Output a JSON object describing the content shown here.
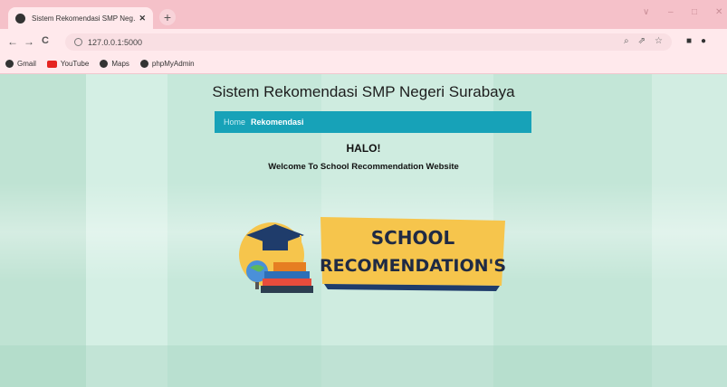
{
  "browser": {
    "tab_title": "Sistem Rekomendasi SMP Neg…",
    "tab_close": "✕",
    "new_tab": "+",
    "url": "127.0.0.1:5000",
    "nav_icons": {
      "back": "←",
      "forward": "→",
      "reload": "C"
    },
    "window_controls": {
      "minimize": "–",
      "maximize": "□",
      "close": "✕",
      "dropdown": "∨"
    },
    "omnibox_icons": {
      "zoom": "⌕",
      "share": "⇗",
      "star": "☆"
    },
    "extension_icons": {
      "sidepanel": "■",
      "profile": "●"
    },
    "bookmarks": [
      {
        "label": "Gmail",
        "icon": "globe-icon"
      },
      {
        "label": "YouTube",
        "icon": "youtube-icon"
      },
      {
        "label": "Maps",
        "icon": "globe-icon"
      },
      {
        "label": "phpMyAdmin",
        "icon": "globe-icon"
      }
    ]
  },
  "page": {
    "site_title": "Sistem Rekomendasi SMP Negeri Surabaya",
    "nav": {
      "home": "Home",
      "rekomendasi": "Rekomendasi"
    },
    "greeting": "HALO!",
    "welcome": "Welcome To School Recommendation Website",
    "banner": {
      "line1": "SCHOOL",
      "line2": "RECOMENDATION'S"
    }
  },
  "colors": {
    "tabbar": "#f5c1c9",
    "navbar": "#17a2b8",
    "background": "#cdebdf",
    "banner_yellow": "#f6c54c",
    "banner_navy": "#1f3c6b"
  }
}
